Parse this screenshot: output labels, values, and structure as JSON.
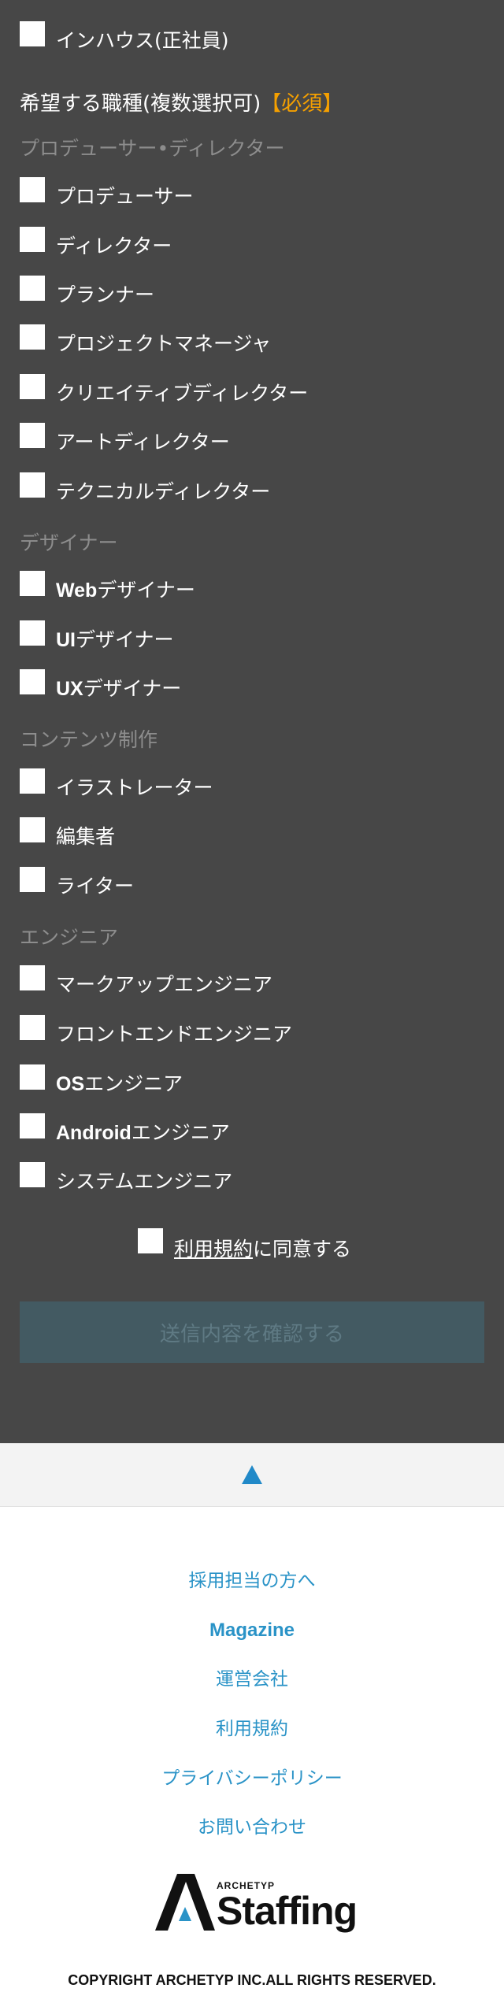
{
  "employment": {
    "inhouse_label": "インハウス(正社員)"
  },
  "job_section": {
    "title": "希望する職種(複数選択可)",
    "required": "【必須】"
  },
  "groups": {
    "producer": {
      "heading": "プロデューサー•ディレクター",
      "items": [
        "プロデューサー",
        "ディレクター",
        "プランナー",
        "プロジェクトマネージャ",
        "クリエイティブディレクター",
        "アートディレクター",
        "テクニカルディレクター"
      ]
    },
    "designer": {
      "heading": "デザイナー",
      "items": [
        {
          "latin": "Web",
          "jp": "デザイナー"
        },
        {
          "latin": "UI",
          "jp": "デザイナー"
        },
        {
          "latin": "UX",
          "jp": "デザイナー"
        }
      ]
    },
    "content": {
      "heading": "コンテンツ制作",
      "items": [
        "イラストレーター",
        "編集者",
        "ライター"
      ]
    },
    "engineer": {
      "heading": "エンジニア",
      "items": [
        {
          "latin": "",
          "jp": "マークアップエンジニア"
        },
        {
          "latin": "",
          "jp": "フロントエンドエンジニア"
        },
        {
          "latin": "OS",
          "jp": "エンジニア"
        },
        {
          "latin": "Android",
          "jp": "エンジニア"
        },
        {
          "latin": "",
          "jp": "システムエンジニア"
        }
      ]
    }
  },
  "agree": {
    "link_text": "利用規約",
    "suffix": "に同意する"
  },
  "submit_label": "送信内容を確認する",
  "footer": {
    "links": [
      "採用担当の方へ",
      "Magazine",
      "運営会社",
      "利用規約",
      "プライバシーポリシー",
      "お問い合わせ"
    ],
    "logo_small": "ARCHETYP",
    "logo_big": "Staffing",
    "copyright": "COPYRIGHT ARCHETYP INC.ALL RIGHTS RESERVED."
  },
  "colors": {
    "form_bg": "#474747",
    "accent_required": "#f5a000",
    "link_blue": "#2a93c7",
    "pagetop_arrow": "#2189c8"
  }
}
